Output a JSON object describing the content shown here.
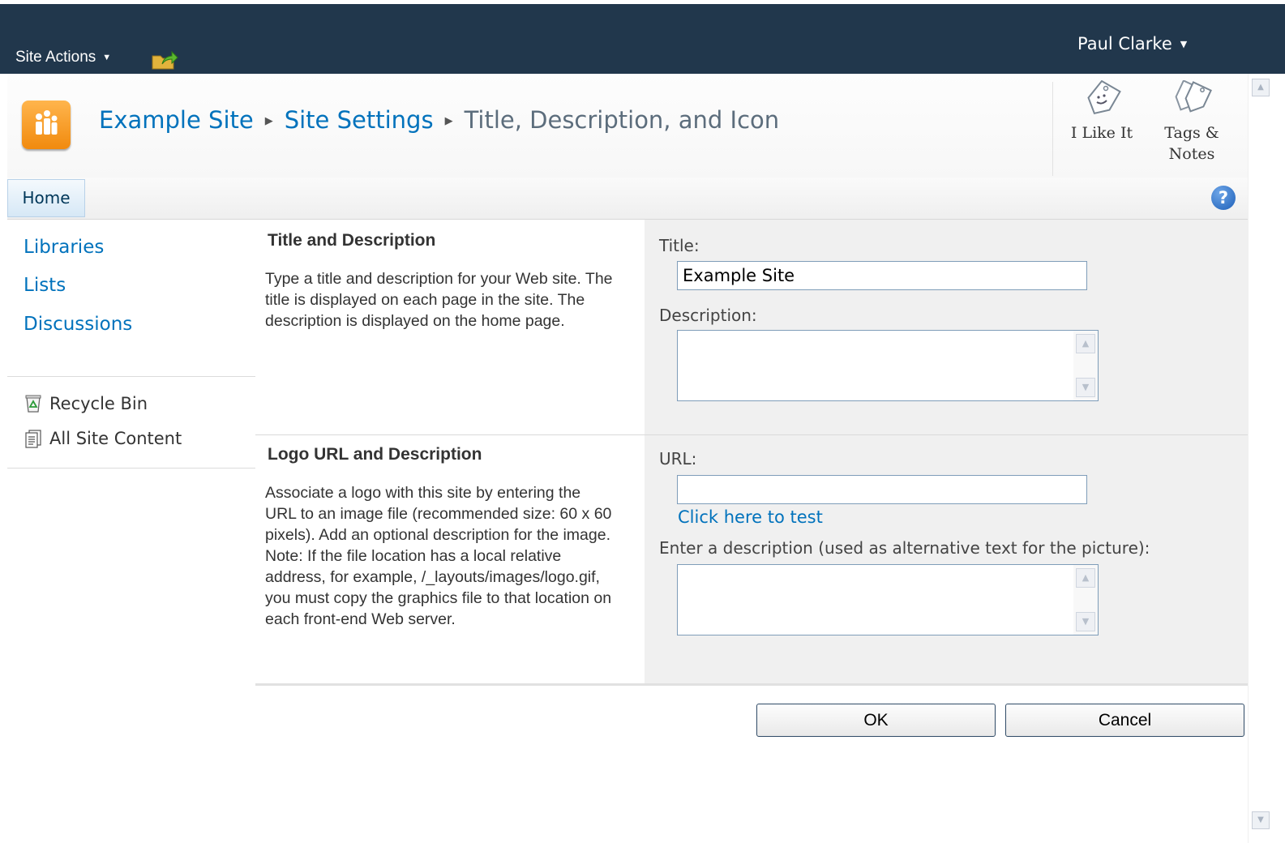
{
  "topbar": {
    "site_actions_label": "Site Actions",
    "user_name": "Paul Clarke",
    "background_color": "#21374c"
  },
  "breadcrumb": {
    "site": "Example Site",
    "settings": "Site Settings",
    "current": "Title, Description, and Icon"
  },
  "social": {
    "like_label": "I Like It",
    "tags_label_line1": "Tags &",
    "tags_label_line2": "Notes"
  },
  "topnav": {
    "home_tab": "Home",
    "help_glyph": "?"
  },
  "leftnav": {
    "links": [
      "Libraries",
      "Lists",
      "Discussions"
    ],
    "recycle_bin": "Recycle Bin",
    "all_site_content": "All Site Content"
  },
  "sections": {
    "title_desc": {
      "heading": "Title and Description",
      "description": "Type a title and description for your Web site. The title is displayed on each page in the site. The description is displayed on the home page.",
      "title_label": "Title:",
      "title_value": "Example Site",
      "description_label": "Description:",
      "description_value": ""
    },
    "logo": {
      "heading": "Logo URL and Description",
      "description": "Associate a logo with this site by entering the URL to an image file (recommended size: 60 x 60 pixels). Add an optional description for the image. Note: If the file location has a local relative address, for example, /_layouts/images/logo.gif, you must copy the graphics file to that location on each front-end Web server.",
      "url_label": "URL:",
      "url_value": "",
      "test_link": "Click here to test",
      "alt_label": "Enter a description (used as alternative text for the picture):",
      "alt_value": ""
    }
  },
  "buttons": {
    "ok": "OK",
    "cancel": "Cancel"
  },
  "colors": {
    "link": "#0072bc",
    "section_bg": "#f0f0f0",
    "site_icon": "#f18a0e"
  }
}
